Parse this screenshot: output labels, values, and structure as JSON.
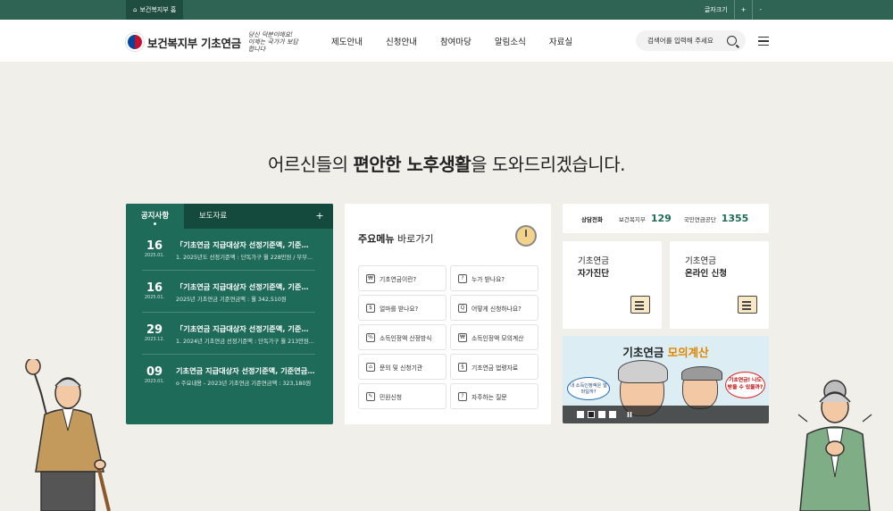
{
  "util": {
    "home_label": "보건복지부 홈",
    "font_size_label": "글자크기",
    "plus": "+",
    "minus": "-"
  },
  "header": {
    "logo_text": "보건복지부 기초연금",
    "slogan": "당신 덕분이에요! 이제는 국가가 보답합니다",
    "nav": [
      "제도안내",
      "신청안내",
      "참여마당",
      "알림소식",
      "자료실"
    ],
    "search_placeholder": "검색어를 입력해 주세요"
  },
  "hero": {
    "pre": "어르신들의 ",
    "bold": "편안한 노후생활",
    "post": "을 도와드리겠습니다."
  },
  "notice": {
    "tabs": [
      "공지사항",
      "보도자료"
    ],
    "more": "+",
    "items": [
      {
        "day": "16",
        "ym": "2025.01.",
        "title": "「기초연금 지급대상자 선정기준액, 기준연금...",
        "desc": "1. 2025년도 선정기준액 : 단독가구 월 228만원 / 부부..."
      },
      {
        "day": "16",
        "ym": "2025.01.",
        "title": "「기초연금 지급대상자 선정기준액, 기준연금...",
        "desc": "2025년 기초연금 기준연금액 : 월 342,510원"
      },
      {
        "day": "29",
        "ym": "2023.12.",
        "title": "「기초연금 지급대상자 선정기준액, 기준연금...",
        "desc": "1. 2024년 기초연금 선정기준액 : 단독가구 월 213만원 /..."
      },
      {
        "day": "09",
        "ym": "2023.01.",
        "title": "기초연금 지급대상자 선정기준액, 기준연금액...",
        "desc": "o 주요내용 - 2023년 기초연금 기준연금액 : 323,180원"
      }
    ]
  },
  "mainmenu": {
    "title_bold": "주요메뉴",
    "title_rest": " 바로가기",
    "buttons": [
      {
        "label": "기초연금이란?",
        "icon": "₩"
      },
      {
        "label": "누가 받나요?",
        "icon": "?"
      },
      {
        "label": "얼마를 받나요?",
        "icon": "$"
      },
      {
        "label": "어떻게 신청하나요?",
        "icon": "Q"
      },
      {
        "label": "소득인정액 산정방식",
        "icon": "%"
      },
      {
        "label": "소득인정액 모의계산",
        "icon": "₩"
      },
      {
        "label": "문의 및 신청기관",
        "icon": "⌂"
      },
      {
        "label": "기초연금 법령자료",
        "icon": "§"
      },
      {
        "label": "민원신청",
        "icon": "✎"
      },
      {
        "label": "자주하는 질문",
        "icon": "?"
      }
    ]
  },
  "contact": {
    "label": "상담전화",
    "items": [
      {
        "name": "보건복지부",
        "num": "129"
      },
      {
        "name": "국민연금공단",
        "num": "1355"
      }
    ]
  },
  "cards": [
    {
      "line1": "기초연금",
      "line2": "자가진단"
    },
    {
      "line1": "기초연금",
      "line2": "온라인 신청"
    }
  ],
  "banner": {
    "title_pre": "기초연금 ",
    "title_hl": "모의계산",
    "bubble_left": "내 소득인정액은 얼마일까?",
    "bubble_right": "기초연금! 나도 받을 수 있을까?",
    "pause": "II"
  }
}
